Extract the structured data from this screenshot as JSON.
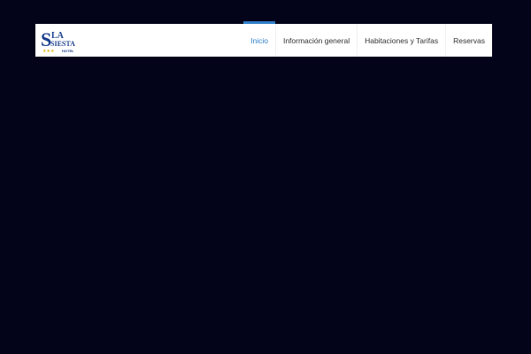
{
  "site": {
    "logo": {
      "line1": "LA",
      "line2": "SIESTA",
      "line3": "HOTEL",
      "stars": "★★★",
      "brand_color": "#1b3f8f",
      "star_color": "#e2b319"
    }
  },
  "nav": {
    "items": [
      {
        "label": "Inicio",
        "active": true
      },
      {
        "label": "Información general",
        "active": false
      },
      {
        "label": "Habitaciones y Tarifas",
        "active": false
      },
      {
        "label": "Reservas",
        "active": false
      }
    ],
    "accent_color": "#2f7ec8"
  },
  "colors": {
    "page_background": "#03031a",
    "header_background": "#ffffff"
  }
}
